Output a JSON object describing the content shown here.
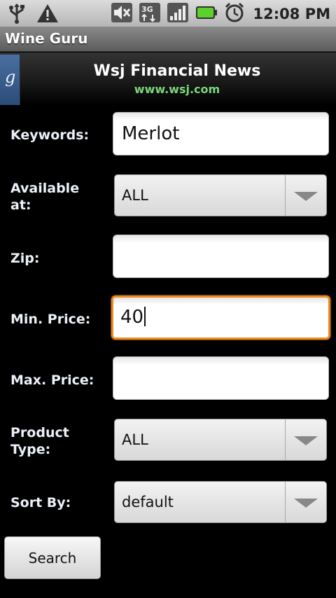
{
  "status_bar": {
    "time": "12:08 PM",
    "icons": [
      "usb-icon",
      "warning-icon",
      "mute-icon",
      "3g-icon",
      "signal-icon",
      "battery-icon",
      "alarm-icon"
    ],
    "network_label": "3G"
  },
  "app_title": "Wine Guru",
  "header": {
    "tab_letter": "g",
    "title": "Wsj Financial News",
    "url": "www.wsj.com"
  },
  "form": {
    "keywords_label": "Keywords:",
    "keywords_value": "Merlot",
    "available_label": "Available at:",
    "available_value": "ALL",
    "zip_label": "Zip:",
    "zip_value": "",
    "min_price_label": "Min. Price:",
    "min_price_value": "40",
    "max_price_label": "Max. Price:",
    "max_price_value": "",
    "product_type_label": "Product Type:",
    "product_type_value": "ALL",
    "sort_by_label": "Sort By:",
    "sort_by_value": "default"
  },
  "search_button_label": "Search",
  "colors": {
    "focus_accent": "#ee8a1c",
    "url_green": "#7bd67b",
    "google_tab": "#3a5d8f"
  }
}
